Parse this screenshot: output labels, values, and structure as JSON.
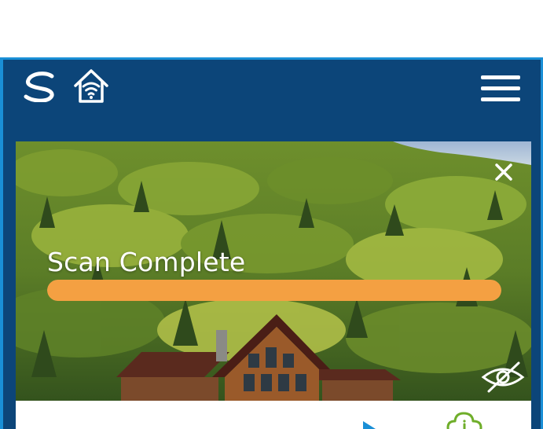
{
  "header": {
    "logo_icon": "swirl-logo-icon",
    "home_icon": "home-wifi-icon",
    "menu_icon": "hamburger-menu-icon"
  },
  "hero": {
    "scan_title": "Scan Complete",
    "progress": 1.0,
    "progress_color": "#f4a042",
    "close_icon": "close-icon",
    "visibility_icon": "eye-slash-icon"
  },
  "bottom_panel": {
    "play_icon": "play-icon",
    "cloud_icon": "cloud-info-icon"
  },
  "colors": {
    "header_bg": "#0c4579",
    "frame_border": "#1a8fd6",
    "accent": "#f4a042"
  }
}
